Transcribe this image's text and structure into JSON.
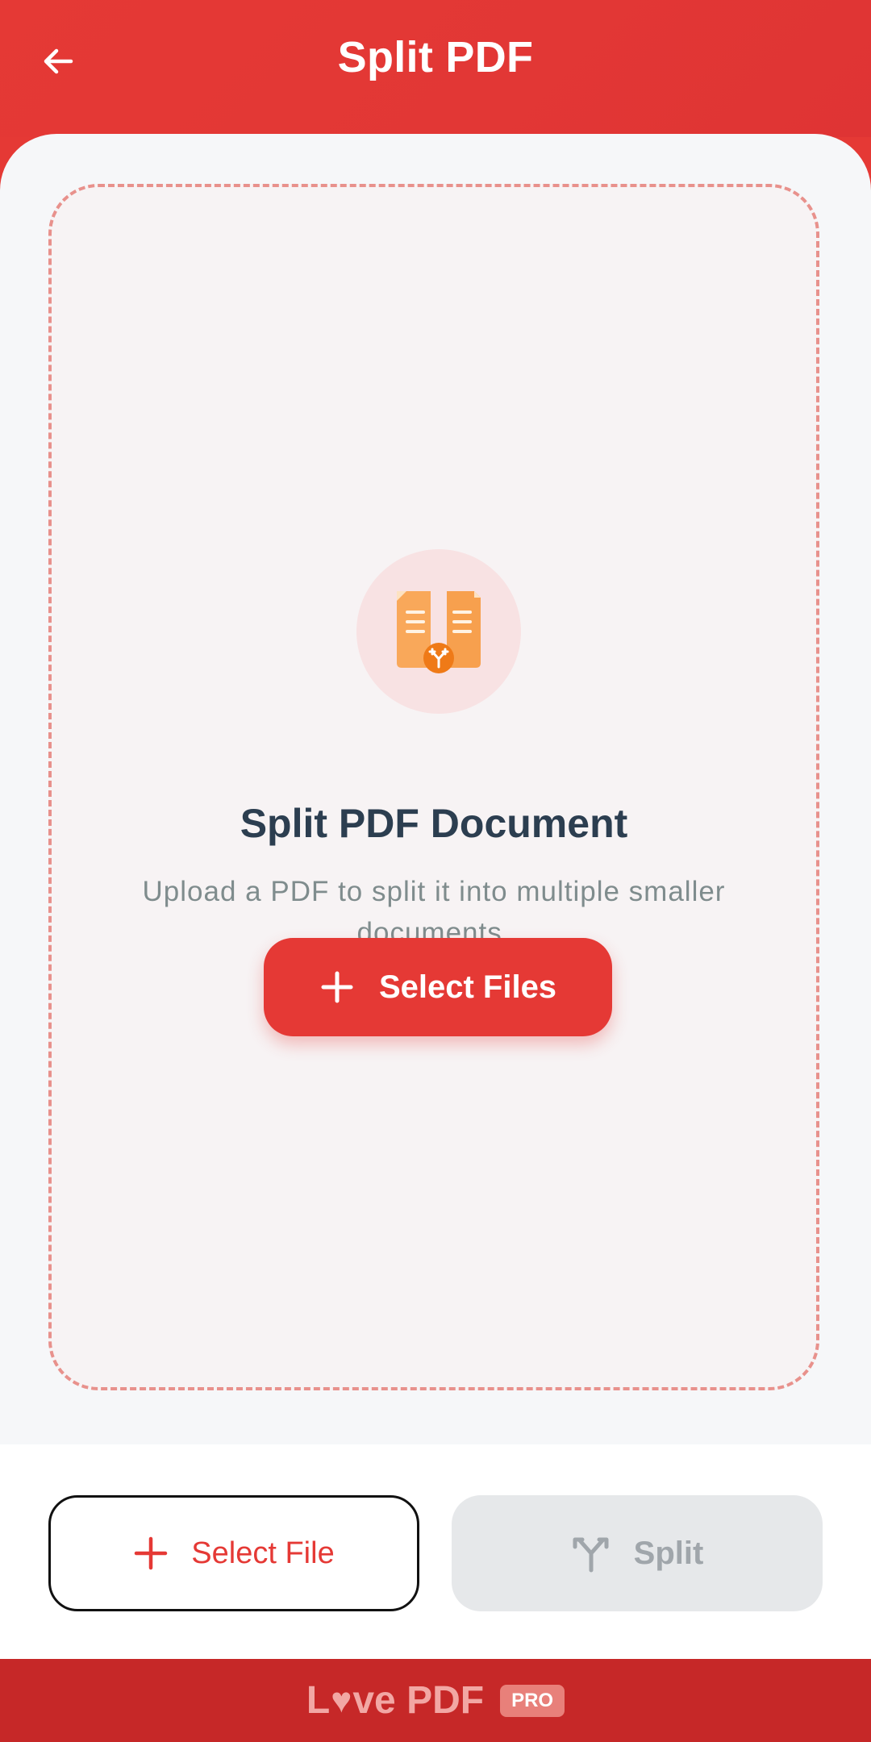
{
  "header": {
    "title": "Split PDF",
    "back_icon": "arrow-left-icon"
  },
  "upload": {
    "title": "Split PDF Document",
    "subtitle": "Upload a PDF to split it into multiple smaller documents.",
    "select_files_label": "Select Files",
    "icon": "split-document-icon"
  },
  "actions": {
    "select_file_label": "Select File",
    "split_label": "Split",
    "split_enabled": false
  },
  "footer": {
    "brand_prefix": "L",
    "brand_heart": "♥",
    "brand_suffix": "ve PDF",
    "badge": "PRO"
  },
  "colors": {
    "primary": "#e53935",
    "footer": "#c62828",
    "dashed_border": "#e8918c",
    "disabled_bg": "#e6e8ea"
  }
}
